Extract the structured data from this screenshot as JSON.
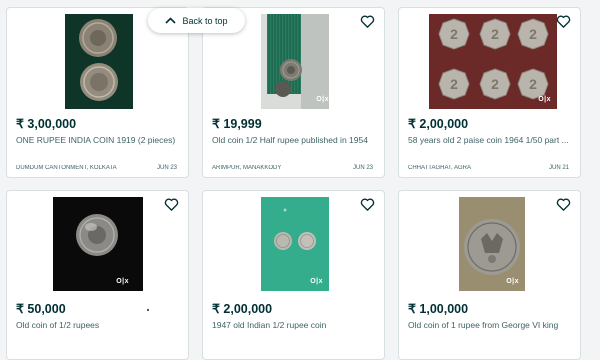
{
  "back_to_top": {
    "label": "Back to top"
  },
  "listings": [
    {
      "price": "₹ 3,00,000",
      "title": "ONE RUPEE INDIA COIN 1919 (2 pieces)",
      "location": "DUMDUM CANTONMENT, KOLKATA",
      "date": "JUN 23"
    },
    {
      "price": "₹ 19,999",
      "title": "Old coin 1/2 Half rupee published in 1954",
      "location": "ARIMPUR, MANAKKODY",
      "date": "JUN 23"
    },
    {
      "price": "₹ 2,00,000",
      "title": "58 years old 2 paise coin 1964 1/50 part ...",
      "location": "CHHATTAGHAT, AGRA",
      "date": "JUN 21"
    },
    {
      "price": "₹ 50,000",
      "title": "Old coin of 1/2 rupees"
    },
    {
      "price": "₹ 2,00,000",
      "title": "1947 old Indian 1/2 rupee coin"
    },
    {
      "price": "₹ 1,00,000",
      "title": "Old coin of 1 rupee from George VI king"
    }
  ],
  "watermark": "O|x",
  "colors": {
    "text_dark": "#002f34",
    "text_muted": "#406367",
    "card_border": "#d8dfe0",
    "page_bg": "#f2f4f5"
  }
}
